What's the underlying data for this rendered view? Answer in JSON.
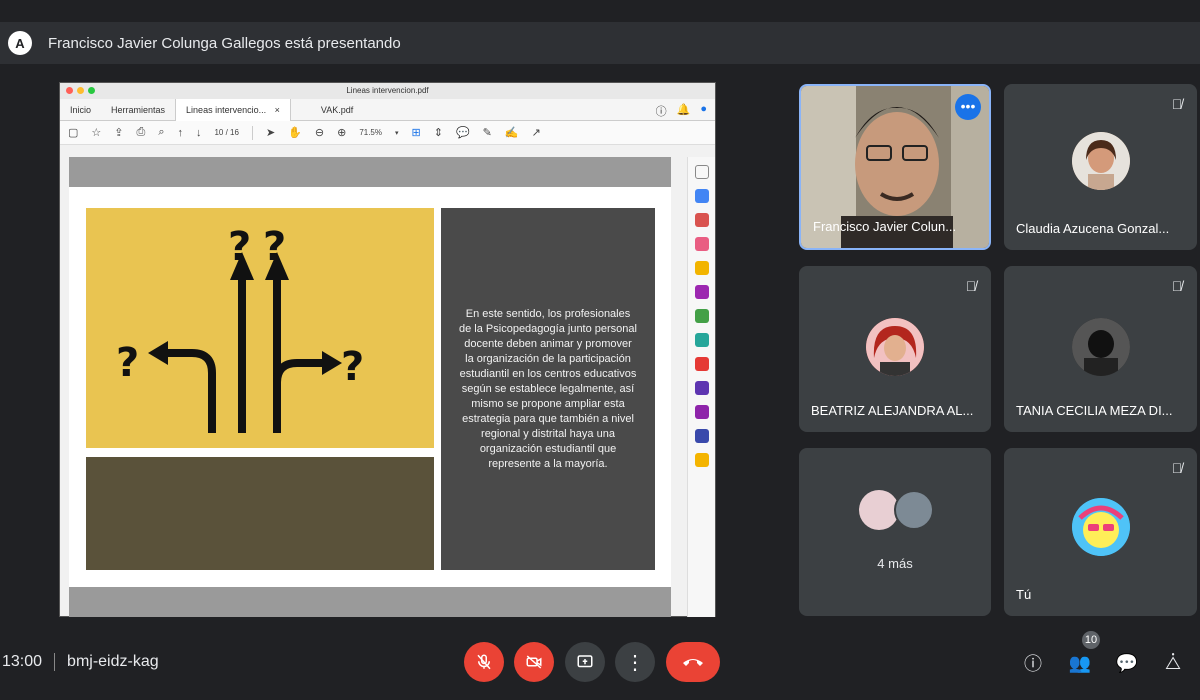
{
  "banner": {
    "presenter_text": "Francisco Javier Colunga Gallegos está presentando"
  },
  "shared_screen": {
    "window_title": "Lineas intervencion.pdf",
    "tabs": [
      "Inicio",
      "Herramientas",
      "Lineas intervencio...",
      "VAK.pdf"
    ],
    "page_indicator": "10 / 16",
    "zoom": "71.5%",
    "slide": {
      "body_text": "En este sentido, los profesionales de la Psicopedagogía junto personal docente deben animar y promover la organización de la participación estudiantil en los centros educativos según se establece legalmente, así mismo se propone ampliar esta estrategia para que también a nivel regional y distrital haya una organización estudiantil que represente a la mayoría."
    }
  },
  "participants": [
    {
      "name": "Francisco Javier Colun...",
      "role": "presenter"
    },
    {
      "name": "Claudia Azucena Gonzal...",
      "muted": true
    },
    {
      "name": "BEATRIZ ALEJANDRA AL...",
      "muted": true
    },
    {
      "name": "TANIA CECILIA MEZA DI...",
      "muted": true
    },
    {
      "name": "4 más"
    },
    {
      "name": "Tú",
      "muted": true
    }
  ],
  "meeting": {
    "time": "13:00",
    "code": "bmj-eidz-kag",
    "participant_count": "10"
  },
  "colors": {
    "end_call": "#ea4335",
    "slide_yellow": "#e9c451",
    "slide_dark": "#4a4a4a",
    "active_border": "#8ab4f8"
  }
}
